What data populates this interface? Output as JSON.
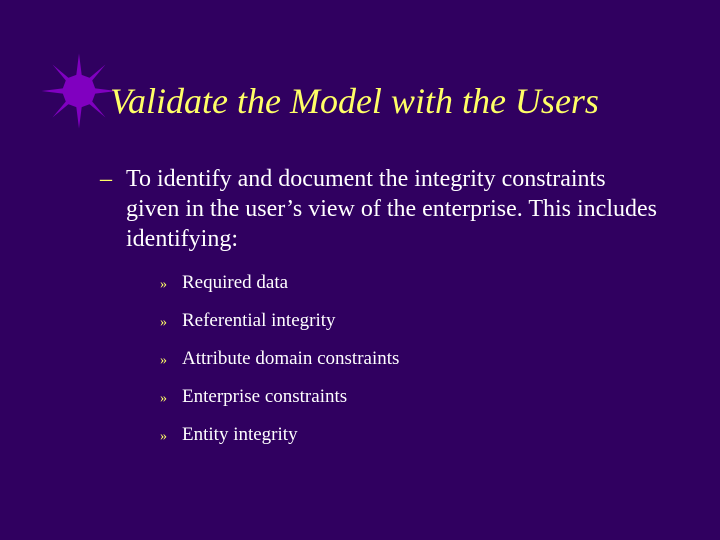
{
  "title": "Validate the Model with the Users",
  "body": {
    "intro": "To identify and document the integrity constraints given in the user’s view of the enterprise.  This includes identifying:",
    "items": [
      "Required data",
      "Referential integrity",
      "Attribute domain constraints",
      "Enterprise constraints",
      "Entity integrity"
    ]
  },
  "bullets": {
    "level1": "–",
    "level2": "»"
  }
}
